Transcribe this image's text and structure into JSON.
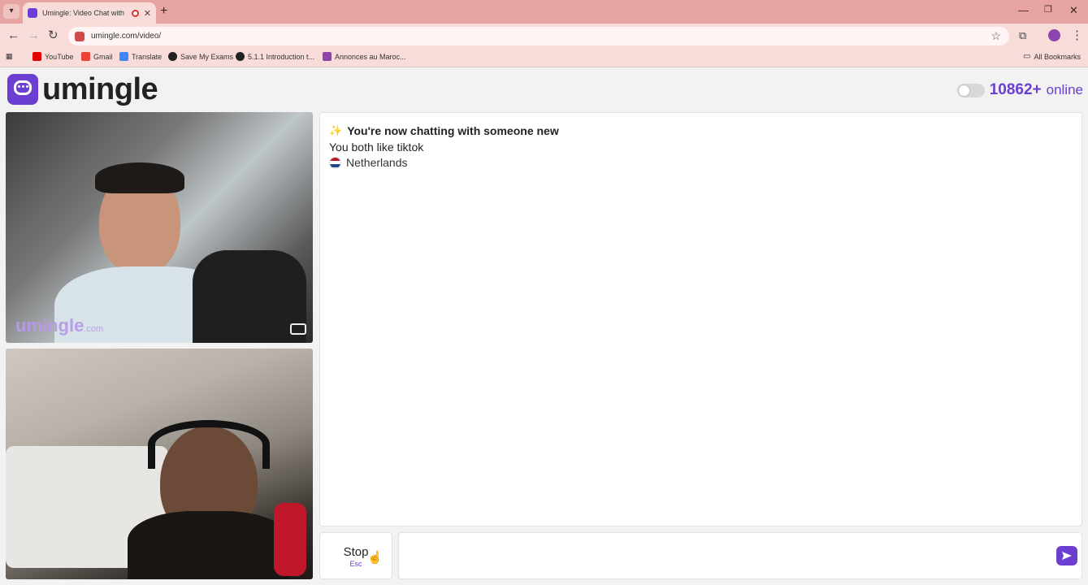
{
  "browser": {
    "tab_title": "Umingle: Video Chat with Str",
    "url": "umingle.com/video/",
    "bookmarks": [
      {
        "label": "YouTube",
        "icon": "youtube-icon",
        "color": "#e00000"
      },
      {
        "label": "Gmail",
        "icon": "gmail-icon",
        "color": "#ea4335"
      },
      {
        "label": "Translate",
        "icon": "translate-icon",
        "color": "#4285f4"
      },
      {
        "label": "Save My Exams",
        "icon": "globe-icon",
        "color": "#222222"
      },
      {
        "label": "5.1.1 Introduction t...",
        "icon": "globe-icon",
        "color": "#222222"
      },
      {
        "label": "Annonces au Maroc...",
        "icon": "site-icon",
        "color": "#8e44ad"
      }
    ],
    "all_bookmarks": "All Bookmarks"
  },
  "header": {
    "logo_text": "umingle",
    "online_count": "10862+",
    "online_label": "online"
  },
  "videos": {
    "watermark": "umingle",
    "watermark_suffix": ".com"
  },
  "chat": {
    "intro_icon": "sparkle-icon",
    "intro": "You're now chatting with someone new",
    "common_interest": "You both like tiktok",
    "country": "Netherlands",
    "flag_colors": [
      "#ae1c28",
      "#ffffff",
      "#21468b"
    ]
  },
  "controls": {
    "stop_label": "Stop",
    "stop_shortcut": "Esc",
    "message_placeholder": ""
  },
  "colors": {
    "brand": "#6a3fd1",
    "chrome": "#e8a4a0"
  }
}
